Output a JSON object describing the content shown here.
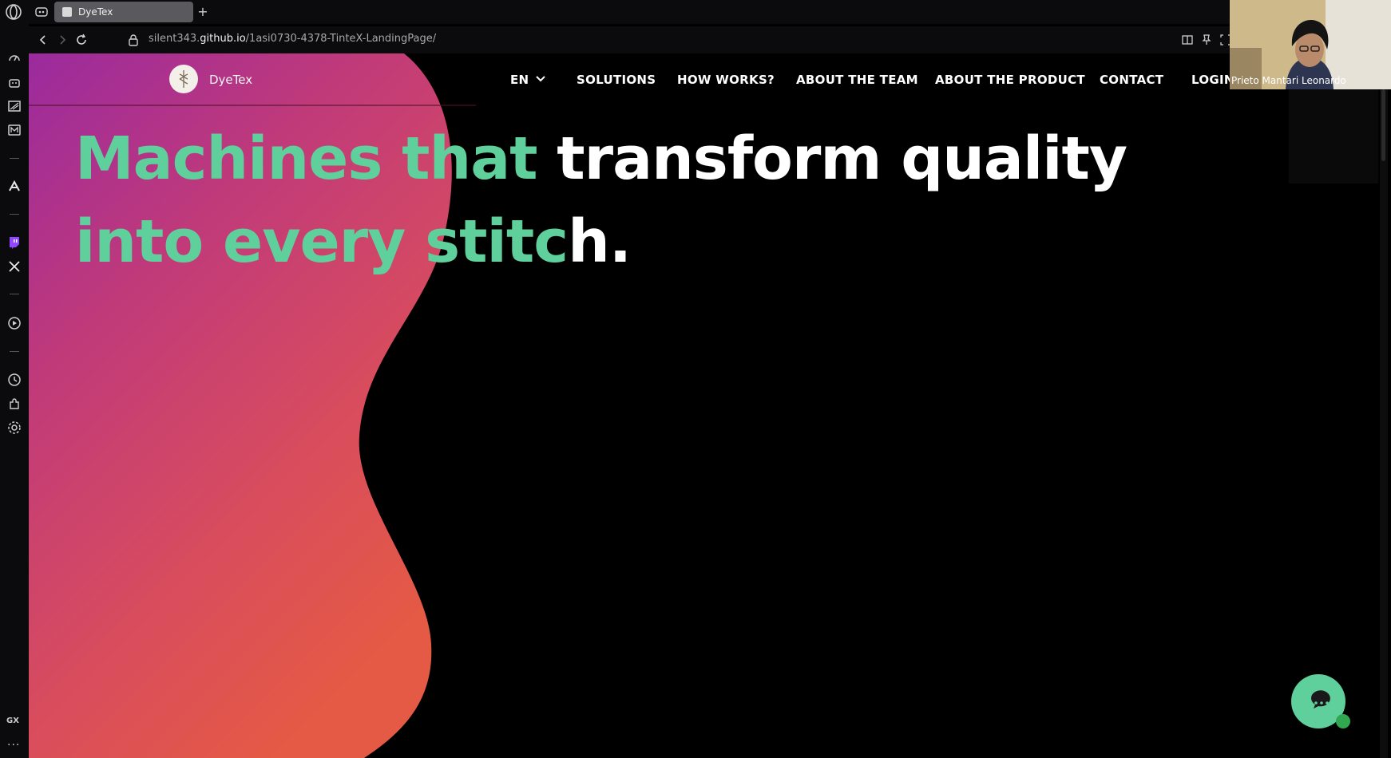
{
  "browser": {
    "tab_title": "DyeTex",
    "url_prefix": "silent343.",
    "url_domain": "github.io",
    "url_path": "/1asi0730-4378-TinteX-LandingPage/"
  },
  "site": {
    "brand": "DyeTex",
    "nav": {
      "lang": "EN",
      "items": [
        "SOLUTIONS",
        "HOW WORKS?",
        "ABOUT THE TEAM",
        "ABOUT THE PRODUCT",
        "CONTACT",
        "LOGIN"
      ]
    },
    "hero": {
      "line1_green": "Machines that ",
      "line1_white": "transform quality",
      "line2_green": "into every stitc",
      "line2_white": "h."
    }
  },
  "webcam": {
    "name": "Prieto Mantari Leonardo"
  },
  "sidebar": {
    "gx": "GX",
    "more": "···"
  },
  "colors": {
    "accent_green": "#5fcf9c",
    "blob_top": "#a0289a",
    "blob_bottom": "#e85740",
    "background": "#000000"
  },
  "icons": {
    "chat": "chat-bubble-icon",
    "chevron": "chevron-down-icon",
    "lock": "lock-icon"
  }
}
